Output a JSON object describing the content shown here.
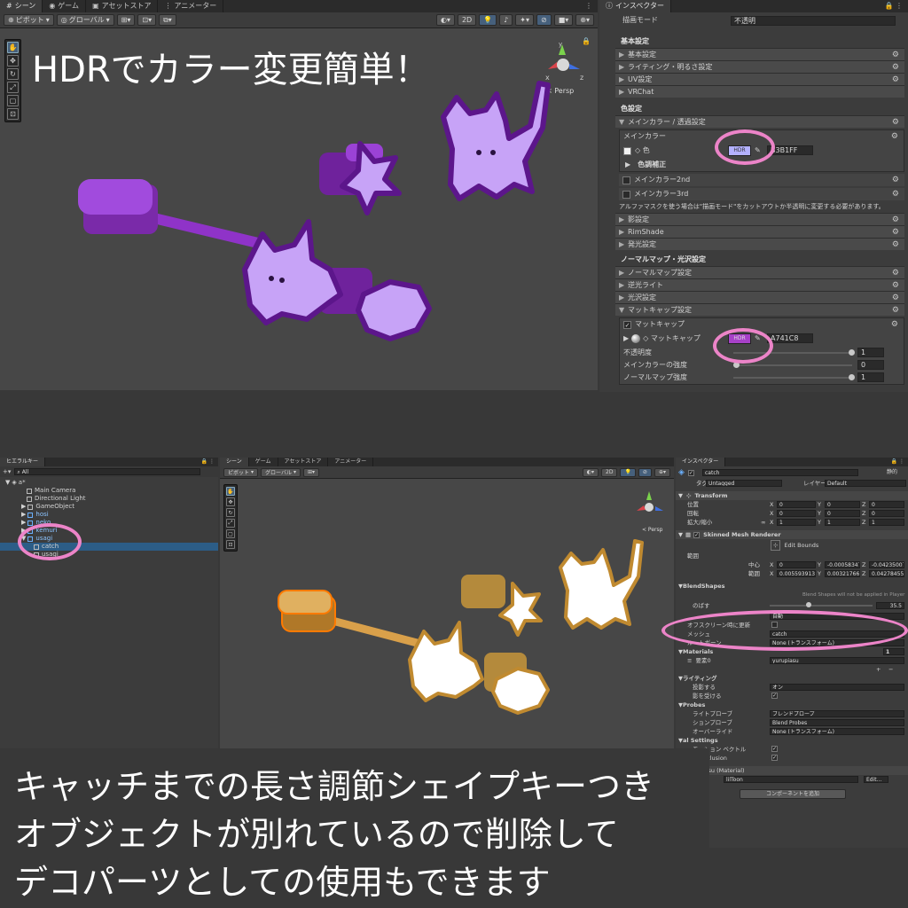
{
  "top": {
    "scene_tabs": [
      "シーン",
      "ゲーム",
      "アセットストア",
      "アニメーター"
    ],
    "toolbar": {
      "pivot": "ピボット",
      "global": "グローバル",
      "mode2d": "2D"
    },
    "persp": "< Persp",
    "headline": "HDRでカラー変更簡単！",
    "inspector": {
      "tab": "インスペクター",
      "render_mode_label": "描画モード",
      "render_mode_value": "不透明",
      "basic_header": "基本設定",
      "basic_items": [
        "基本設定",
        "ライティング・明るさ設定",
        "UV設定",
        "VRChat"
      ],
      "color_header": "色設定",
      "main_color_section": "メインカラー / 透過設定",
      "main_color_label": "メインカラー",
      "color_label": "◇ 色",
      "hdr": "HDR",
      "main_hex": "B3B1FF",
      "tone_correction": "色調補正",
      "main2": "メインカラー2nd",
      "main3": "メインカラー3rd",
      "alpha_note": "アルファマスクを使う場合は\"描画モード\"をカットアウトか半透明に変更する必要があります。",
      "other_items": [
        "影設定",
        "RimShade",
        "発光設定"
      ],
      "normal_header": "ノーマルマップ・光沢設定",
      "normal_items": [
        "ノーマルマップ設定",
        "逆光ライト",
        "光沢設定",
        "マットキャップ設定"
      ],
      "matcap_section": "マットキャップ",
      "matcap_label": "◇ マットキャップ",
      "matcap_hex": "A741C8",
      "opacity_label": "不透明度",
      "opacity_value": "1",
      "main_strength_label": "メインカラーの強度",
      "main_strength_value": "0",
      "normal_strength_label": "ノーマルマップ強度",
      "normal_strength_value": "1"
    }
  },
  "bottom": {
    "hierarchy": {
      "tab": "ヒエラルキー",
      "search_placeholder": "All",
      "items": [
        "a*",
        "Main Camera",
        "Directional Light",
        "GameObject",
        "hosi",
        "neko",
        "kemuri",
        "usagi",
        "catch",
        "usagi"
      ]
    },
    "scene_tabs": [
      "シーン",
      "ゲーム",
      "アセットストア",
      "アニメーター"
    ],
    "toolbar": {
      "pivot": "ピボット",
      "global": "グローバル",
      "mode2d": "2D"
    },
    "persp": "< Persp",
    "inspector": {
      "tab": "インスペクター",
      "object_name": "catch",
      "static": "静的",
      "tag_label": "タグ",
      "tag_value": "Untagged",
      "layer_label": "レイヤー",
      "layer_value": "Default",
      "transform": "Transform",
      "pos_label": "位置",
      "rot_label": "回転",
      "scale_label": "拡大/縮小",
      "pos": [
        "0",
        "0",
        "0"
      ],
      "rot": [
        "0",
        "0",
        "0"
      ],
      "scale": [
        "1",
        "1",
        "1"
      ],
      "smr": "Skinned Mesh Renderer",
      "edit_bounds": "Edit Bounds",
      "bounds_label": "範囲",
      "center_label": "中心",
      "center": [
        "0",
        "-0.00058347",
        "-0.04235007"
      ],
      "extent_label": "範囲",
      "extent": [
        "0.005593913",
        "0.003217662",
        "0.04278455"
      ],
      "blendshapes": "BlendShapes",
      "blend_note": "Blend Shapes will not be applied in Player",
      "nobasu_label": "のばす",
      "nobasu_value": "35.5",
      "quality_value": "自動",
      "offscreen_label": "オフスクリーン時に更新",
      "mesh_label": "メッシュ",
      "mesh_value": "catch",
      "rootbone_label": "ルートボーン",
      "rootbone_value": "None (トランスフォーム)",
      "materials": "Materials",
      "materials_count": "1",
      "element0_label": "要素0",
      "element0_value": "yurupiasu",
      "lighting": "ライティング",
      "cast_label": "投影する",
      "cast_value": "オン",
      "receive_label": "影を受ける",
      "probes": "Probes",
      "lightprobe_label": "ライトプローブ",
      "lightprobe_value": "ブレンドプローブ",
      "reflprobe_label": "ションプローブ",
      "reflprobe_value": "Blend Probes",
      "anchor_label": "オーバーライド",
      "anchor_value": "None (トランスフォーム)",
      "additional": "al Settings",
      "motion_label": "モーション ベクトル",
      "occlusion_label": "ic Occlusion",
      "material_name": "rurupiasu (Material)",
      "shader_label": "ader",
      "shader_value": "lilToon",
      "edit": "Edit...",
      "add_component": "コンポーネントを追加"
    },
    "caption": [
      "キャッチまでの長さ調節シェイプキーつき",
      "オブジェクトが別れているので削除して",
      "デコパーツとしての使用もできます"
    ]
  },
  "colors": {
    "highlight": "#ec84c8",
    "purple": "#9a3fd1",
    "lilac": "#c7a3f7",
    "gold": "#c9a04a",
    "main_swatch": "#b3b1ff",
    "matcap_swatch": "#a741c8"
  }
}
